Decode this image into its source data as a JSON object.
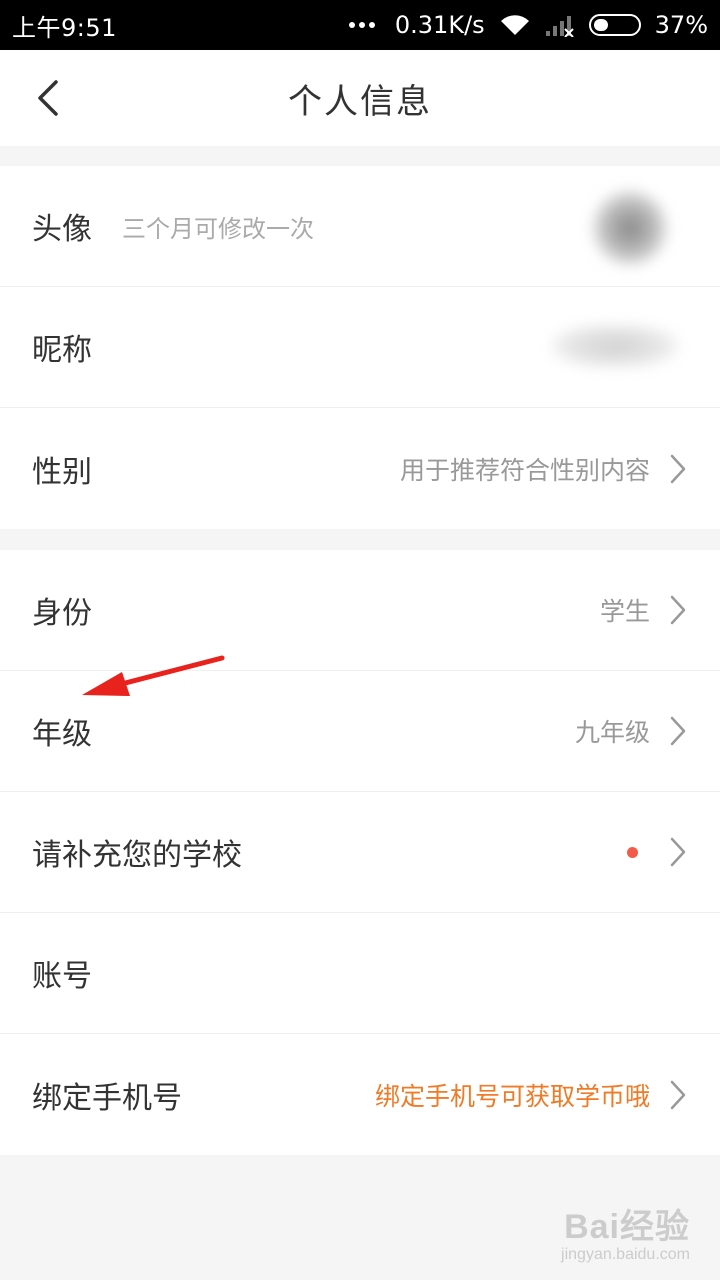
{
  "status_bar": {
    "time": "上午9:51",
    "network_speed": "0.31K/s",
    "battery": "37%",
    "icons": [
      "more-dots-icon",
      "wifi-icon",
      "signal-icon",
      "battery-icon"
    ]
  },
  "header": {
    "title": "个人信息",
    "back_icon": "chevron-left-icon"
  },
  "rows": {
    "avatar": {
      "label": "头像",
      "hint": "三个月可修改一次"
    },
    "nickname": {
      "label": "昵称"
    },
    "gender": {
      "label": "性别",
      "value": "用于推荐符合性别内容"
    },
    "identity": {
      "label": "身份",
      "value": "学生"
    },
    "grade": {
      "label": "年级",
      "value": "九年级"
    },
    "school": {
      "label": "请补充您的学校"
    },
    "account": {
      "label": "账号"
    },
    "phone": {
      "label": "绑定手机号",
      "value": "绑定手机号可获取学币哦"
    }
  },
  "colors": {
    "accent_orange": "#f07a25",
    "badge_red": "#f45a4a",
    "annotation_arrow": "#e8221c",
    "text_primary": "#333333",
    "text_secondary": "#999999"
  },
  "watermark": {
    "main": "Bai经验",
    "sub": "jingyan.baidu.com"
  }
}
